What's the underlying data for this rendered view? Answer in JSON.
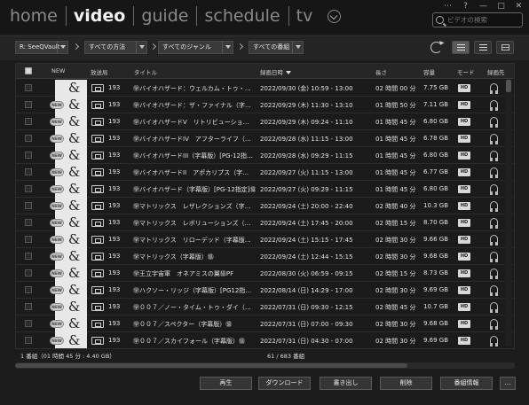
{
  "window_controls": [
    "⋯",
    "?",
    "—",
    "□",
    "✕"
  ],
  "nav": {
    "items": [
      {
        "label": "home",
        "active": false
      },
      {
        "label": "video",
        "active": true
      },
      {
        "label": "guide",
        "active": false
      },
      {
        "label": "schedule",
        "active": false
      },
      {
        "label": "tv",
        "active": false
      }
    ],
    "more_icon": "chevron-down-circle-icon"
  },
  "search": {
    "placeholder": "ビデオの検索",
    "icon": "search-icon"
  },
  "filters": {
    "source": "R: SeeQVault",
    "method": "すべての方法",
    "genre": "すべてのジャンル",
    "program": "すべての番組"
  },
  "columns": {
    "new": "NEW",
    "channel": "放送局",
    "title": "タイトル",
    "date": "録画日時",
    "length": "長さ",
    "size": "容量",
    "mode": "モード",
    "dest": "録画先"
  },
  "rows": [
    {
      "new": false,
      "ch": "193",
      "title": "㊫バイオハザード：ウェルカム・トゥ・…",
      "date": "2022/09/30 (金) 10:59 - 13:00",
      "length": "02 時間 00 分",
      "size": "7.75 GB",
      "mode": "HD"
    },
    {
      "new": true,
      "ch": "193",
      "title": "㊫バイオハザード：ザ・ファイナル（字…",
      "date": "2022/09/29 (木) 11:30 - 13:10",
      "length": "01 時間 50 分",
      "size": "7.11 GB",
      "mode": "HD"
    },
    {
      "new": true,
      "ch": "193",
      "title": "㊫バイオハザードV　リトリビューショ…",
      "date": "2022/09/29 (木) 09:24 - 11:10",
      "length": "01 時間 45 分",
      "size": "6.80 GB",
      "mode": "HD"
    },
    {
      "new": true,
      "ch": "193",
      "title": "㊫バイオハザードIV　アフターライフ（…",
      "date": "2022/09/28 (水) 11:15 - 13:00",
      "length": "01 時間 45 分",
      "size": "6.78 GB",
      "mode": "HD"
    },
    {
      "new": true,
      "ch": "193",
      "title": "㊫バイオハザードIII（字幕版）[PG-12指…",
      "date": "2022/09/28 (水) 09:29 - 11:15",
      "length": "01 時間 45 分",
      "size": "6.80 GB",
      "mode": "HD"
    },
    {
      "new": true,
      "ch": "193",
      "title": "㊫バイオハザードII　アポカリプス（字…",
      "date": "2022/09/27 (火) 11:15 - 13:00",
      "length": "01 時間 45 分",
      "size": "6.77 GB",
      "mode": "HD"
    },
    {
      "new": true,
      "ch": "193",
      "title": "㊫バイオハザード（字幕版）[PG-12指定]㊯",
      "date": "2022/09/27 (火) 09:29 - 11:15",
      "length": "01 時間 45 分",
      "size": "6.80 GB",
      "mode": "HD"
    },
    {
      "new": true,
      "ch": "193",
      "title": "㊫マトリックス　レザレクションズ（字…",
      "date": "2022/09/24 (土) 20:00 - 22:40",
      "length": "02 時間 40 分",
      "size": "10.3 GB",
      "mode": "HD"
    },
    {
      "new": true,
      "ch": "193",
      "title": "㊫マトリックス　レボリューションズ（…",
      "date": "2022/09/24 (土) 17:45 - 20:00",
      "length": "02 時間 15 分",
      "size": "8.70 GB",
      "mode": "HD"
    },
    {
      "new": true,
      "ch": "193",
      "title": "㊫マトリックス　リローデッド（字幕版…",
      "date": "2022/09/24 (土) 15:15 - 17:45",
      "length": "02 時間 30 分",
      "size": "9.66 GB",
      "mode": "HD"
    },
    {
      "new": true,
      "ch": "193",
      "title": "㊫マトリックス（字幕版）㊯",
      "date": "2022/09/24 (土) 12:44 - 15:15",
      "length": "02 時間 30 分",
      "size": "9.68 GB",
      "mode": "HD"
    },
    {
      "new": true,
      "ch": "193",
      "title": "㊫王立宇宙軍　オネアミスの翼㊯PF",
      "date": "2022/08/30 (火) 06:59 - 09:15",
      "length": "02 時間 15 分",
      "size": "8.73 GB",
      "mode": "HD"
    },
    {
      "new": true,
      "ch": "193",
      "title": "㊫ハクソー・リッジ（字幕版）[PG12指…",
      "date": "2022/08/14 (日) 14:29 - 17:00",
      "length": "02 時間 30 分",
      "size": "9.69 GB",
      "mode": "HD"
    },
    {
      "new": true,
      "ch": "193",
      "title": "㊫００７／ノー・タイム・トゥ・ダイ（…",
      "date": "2022/07/31 (日) 09:30 - 12:15",
      "length": "02 時間 45 分",
      "size": "10.7 GB",
      "mode": "HD"
    },
    {
      "new": true,
      "ch": "193",
      "title": "㊫００７／スペクター（字幕版）㊯",
      "date": "2022/07/31 (日) 07:00 - 09:30",
      "length": "02 時間 30 分",
      "size": "9.68 GB",
      "mode": "HD"
    },
    {
      "new": true,
      "ch": "193",
      "title": "㊫００７／スカイフォール（字幕版）㊯",
      "date": "2022/07/31 (日) 04:30 - 07:00",
      "length": "02 時間 30 分",
      "size": "9.69 GB",
      "mode": "HD"
    }
  ],
  "status": {
    "selection": "1 番組（01 時間 45 分 : 4.40 GB）",
    "count": "61 / 683 番組"
  },
  "buttons": {
    "play": "再生",
    "download": "ダウンロード",
    "export": "書き出し",
    "delete": "削除",
    "info": "番組情報",
    "more": "…"
  }
}
